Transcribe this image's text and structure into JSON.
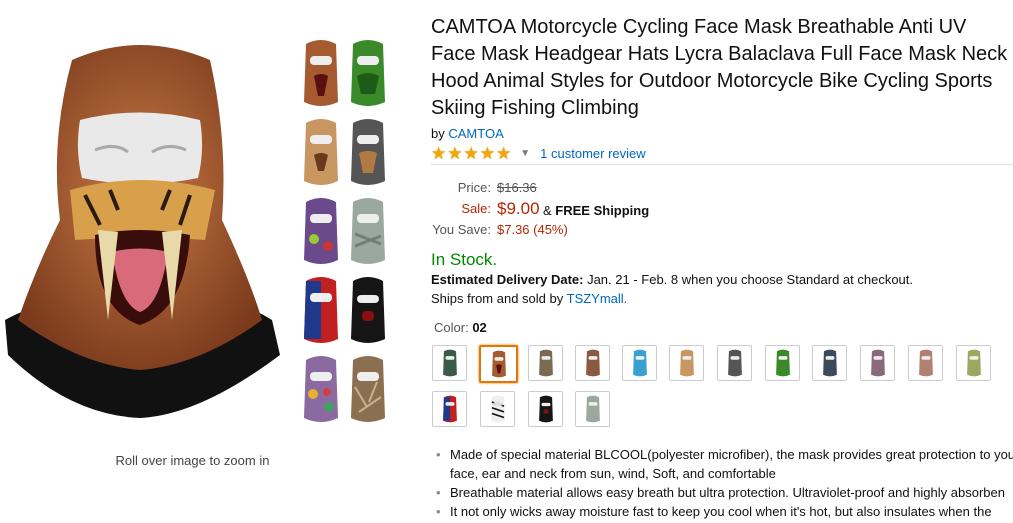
{
  "product": {
    "title": "CAMTOA Motorcycle Cycling Face Mask Breathable Anti UV Face Mask Headgear Hats Lycra Balaclava Full Face Mask Neck Hood Animal Styles for Outdoor Motorcycle Bike Cycling Sports Skiing Fishing Climbing",
    "by_prefix": "by",
    "brand": "CAMTOA",
    "rating_value": 5,
    "rating_max": 5,
    "review_link": "1 customer review",
    "zoom_hint": "Roll over image to zoom in"
  },
  "pricing": {
    "price_label": "Price:",
    "list_price": "$16.36",
    "sale_label": "Sale:",
    "sale_price": "$9.00",
    "shipping_prefix": "&",
    "shipping": "FREE Shipping",
    "save_label": "You Save:",
    "save_value": "$7.36 (45%)"
  },
  "availability": {
    "stock": "In Stock.",
    "delivery_label": "Estimated Delivery Date:",
    "delivery_text": "Jan. 21 - Feb. 8 when you choose Standard at checkout.",
    "shipsfrom_text": "Ships from and sold by",
    "seller": "TSZYmall."
  },
  "color": {
    "label": "Color:",
    "selected": "02"
  },
  "bullets": [
    "Made of special material BLCOOL(polyester microfiber), the mask provides great protection to you face, ear and neck from sun, wind, Soft, and comfortable",
    "Breathable material allows easy breath but ultra protection. Ultraviolet-proof and highly absorben",
    "It not only wicks away moisture fast to keep you cool when it's hot, but also insulates when the"
  ],
  "colors": {
    "accent_orange": "#e77600",
    "sale_red": "#b12704",
    "stock_green": "#008a00",
    "link_blue": "#0066c0"
  }
}
